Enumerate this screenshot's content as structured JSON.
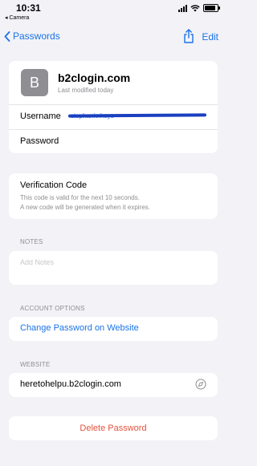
{
  "status_bar": {
    "time": "10:31",
    "back_app": "◂ Camera"
  },
  "nav": {
    "back_label": "Passwords",
    "edit_label": "Edit"
  },
  "account": {
    "avatar_letter": "B",
    "site_title": "b2clogin.com",
    "modified": "Last modified today",
    "username_label": "Username",
    "username_value": "stephanie.hays",
    "password_label": "Password"
  },
  "verification": {
    "title": "Verification Code",
    "line1": "This code is valid for the next 10 seconds.",
    "line2": "A new code will be generated when it expires."
  },
  "notes": {
    "section": "NOTES",
    "placeholder": "Add Notes"
  },
  "account_options": {
    "section": "ACCOUNT OPTIONS",
    "change_password": "Change Password on Website"
  },
  "website": {
    "section": "WEBSITE",
    "value": "heretohelpu.b2clogin.com"
  },
  "delete_label": "Delete Password",
  "colors": {
    "accent": "#1a73e8",
    "destructive": "#e5533d",
    "background": "#f2f2f7"
  }
}
